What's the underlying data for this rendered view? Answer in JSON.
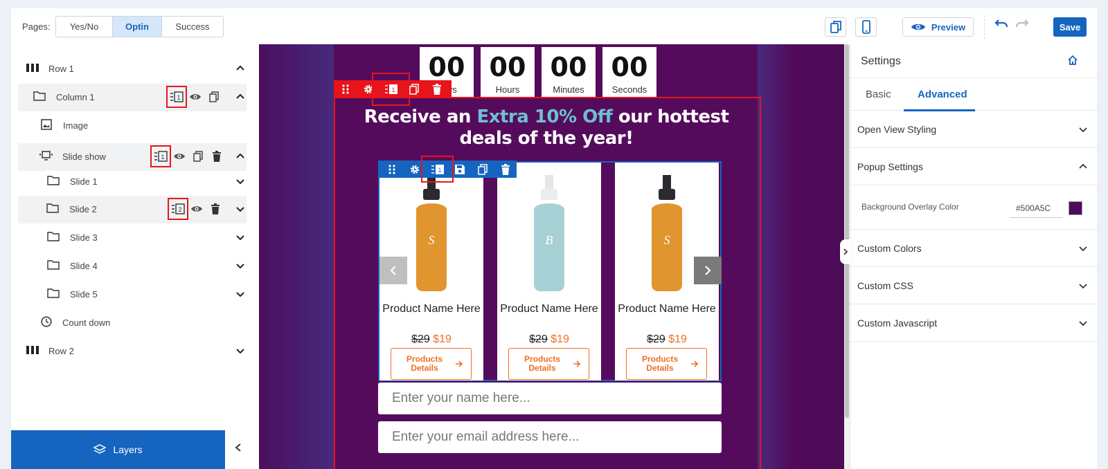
{
  "topbar": {
    "pages_label": "Pages:",
    "page_tabs": [
      {
        "label": "Yes/No"
      },
      {
        "label": "Optin"
      },
      {
        "label": "Success"
      }
    ],
    "preview_label": "Preview",
    "save_label": "Save"
  },
  "layers": {
    "items": [
      {
        "label": "Row 1",
        "icon": "row-icon"
      },
      {
        "label": "Column 1",
        "icon": "folder-icon",
        "badge": "1"
      },
      {
        "label": "Image",
        "icon": "image-icon"
      },
      {
        "label": "Slide show",
        "icon": "slideshow-icon",
        "badge": "1"
      },
      {
        "label": "Slide 1",
        "icon": "folder-icon"
      },
      {
        "label": "Slide 2",
        "icon": "folder-icon",
        "badge": "2"
      },
      {
        "label": "Slide 3",
        "icon": "folder-icon"
      },
      {
        "label": "Slide 4",
        "icon": "folder-icon"
      },
      {
        "label": "Slide 5",
        "icon": "folder-icon"
      },
      {
        "label": "Count down",
        "icon": "clock-icon"
      },
      {
        "label": "Row 2",
        "icon": "row-icon"
      }
    ],
    "panel_label": "Layers"
  },
  "canvas": {
    "countdown": [
      {
        "value": "00",
        "label": "Days"
      },
      {
        "value": "00",
        "label": "Hours"
      },
      {
        "value": "00",
        "label": "Minutes"
      },
      {
        "value": "00",
        "label": "Seconds"
      }
    ],
    "toolbar_badge": "1",
    "headline": {
      "part1": "Receive an ",
      "highlight": "Extra 10% Off",
      "part2": " our hottest deals of the year!"
    },
    "products": [
      {
        "name": "Product Name Here",
        "old_price": "$29",
        "new_price": "$19",
        "cta": "Products Details",
        "color": "#e0952e"
      },
      {
        "name": "Product Name Here",
        "old_price": "$29",
        "new_price": "$19",
        "cta": "Products Details",
        "color": "#a7d1d4"
      },
      {
        "name": "Product Name Here",
        "old_price": "$29",
        "new_price": "$19",
        "cta": "Products Details",
        "color": "#e0952e"
      }
    ],
    "name_placeholder": "Enter your name here...",
    "email_placeholder": "Enter your email address here..."
  },
  "settings": {
    "title": "Settings",
    "tabs": [
      {
        "label": "Basic"
      },
      {
        "label": "Advanced"
      }
    ],
    "sections": [
      {
        "label": "Open View Styling"
      },
      {
        "label": "Popup Settings"
      },
      {
        "label": "Custom Colors"
      },
      {
        "label": "Custom CSS"
      },
      {
        "label": "Custom Javascript"
      }
    ],
    "overlay_label": "Background Overlay Color",
    "overlay_value": "#500A5C"
  },
  "colors": {
    "accent": "#1565c0",
    "danger": "#e8141b",
    "canvas_bg": "#550b5c",
    "highlight_teal": "#6dc0cf",
    "price_orange": "#f26d21"
  }
}
